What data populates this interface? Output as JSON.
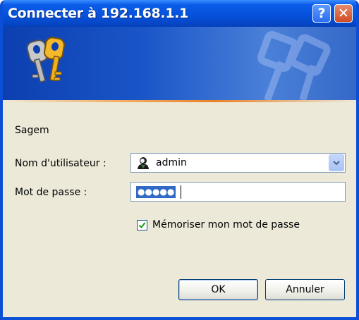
{
  "window": {
    "title": "Connecter à 192.168.1.1",
    "help_glyph": "?",
    "close_glyph": "✕"
  },
  "banner": {
    "icon": "keys-icon"
  },
  "realm": "Sagem",
  "form": {
    "username_label": "Nom d'utilisateur :",
    "username_value": "admin",
    "username_icon": "user-icon",
    "password_label": "Mot de passe :",
    "password_mask": "●●●●●",
    "remember_label": "Mémoriser mon mot de passe",
    "remember_checked": true
  },
  "buttons": {
    "ok": "OK",
    "cancel": "Annuler"
  },
  "colors": {
    "titlebar": "#0652dd",
    "dialog_bg": "#ece9d8",
    "selection": "#316ac5"
  }
}
